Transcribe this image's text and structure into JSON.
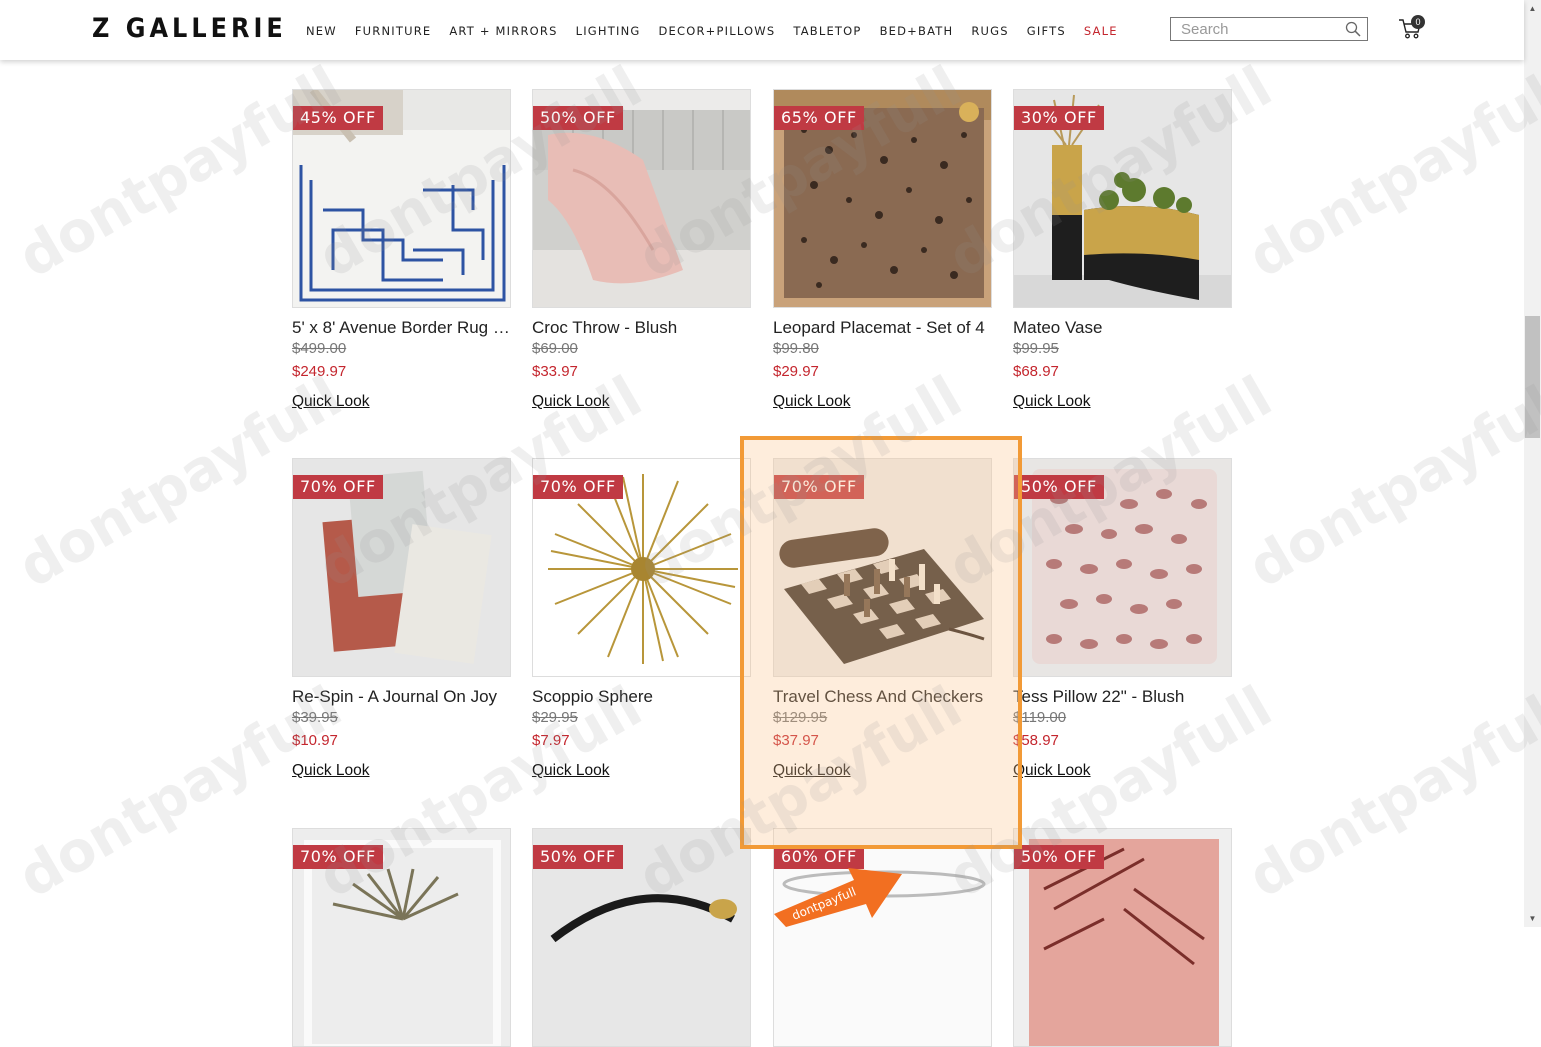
{
  "header": {
    "logo": "Z GALLERIE",
    "nav": [
      "NEW",
      "FURNITURE",
      "ART + MIRRORS",
      "LIGHTING",
      "DECOR+PILLOWS",
      "TABLETOP",
      "BED+BATH",
      "RUGS",
      "GIFTS",
      "SALE"
    ],
    "search_placeholder": "Search",
    "cart_count": "0"
  },
  "products": [
    {
      "badge": "45% OFF",
      "name": "5' x 8' Avenue Border Rug - ...",
      "orig": "$499.00",
      "sale": "$249.97",
      "quick": "Quick Look"
    },
    {
      "badge": "50% OFF",
      "name": "Croc Throw - Blush",
      "orig": "$69.00",
      "sale": "$33.97",
      "quick": "Quick Look"
    },
    {
      "badge": "65% OFF",
      "name": "Leopard Placemat - Set of 4",
      "orig": "$99.80",
      "sale": "$29.97",
      "quick": "Quick Look"
    },
    {
      "badge": "30% OFF",
      "name": "Mateo Vase",
      "orig": "$99.95",
      "sale": "$68.97",
      "quick": "Quick Look"
    },
    {
      "badge": "70% OFF",
      "name": "Re-Spin - A Journal On Joy",
      "orig": "$39.95",
      "sale": "$10.97",
      "quick": "Quick Look"
    },
    {
      "badge": "70% OFF",
      "name": "Scoppio Sphere",
      "orig": "$29.95",
      "sale": "$7.97",
      "quick": "Quick Look"
    },
    {
      "badge": "70% OFF",
      "name": "Travel Chess And Checkers",
      "orig": "$129.95",
      "sale": "$37.97",
      "quick": "Quick Look"
    },
    {
      "badge": "50% OFF",
      "name": "Tess Pillow 22\" - Blush",
      "orig": "$119.00",
      "sale": "$58.97",
      "quick": "Quick Look"
    },
    {
      "badge": "70% OFF"
    },
    {
      "badge": "50% OFF"
    },
    {
      "badge": "60% OFF"
    },
    {
      "badge": "50% OFF"
    }
  ],
  "watermark": "dontpayfull",
  "colors": {
    "badge": "#c03a43",
    "sale_price": "#c4262e",
    "highlight": "#f29a36"
  }
}
